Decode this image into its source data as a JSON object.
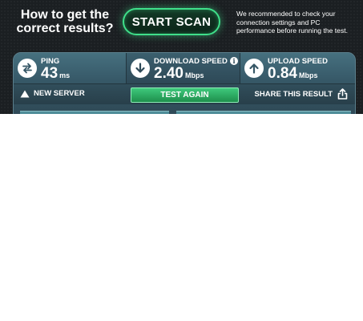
{
  "promo": {
    "heading": "How to get the correct results?",
    "cta_label": "START SCAN",
    "note": "We recommended to check your connection settings and PC performance before running the test.",
    "accent_color": "#3fe08a"
  },
  "results": {
    "ping": {
      "label": "PING",
      "value": "43",
      "unit": "ms",
      "icon": "exchange-arrows-icon"
    },
    "download": {
      "label": "DOWNLOAD SPEED",
      "value": "2.40",
      "unit": "Mbps",
      "icon": "arrow-down-icon",
      "info_icon": "info-icon"
    },
    "upload": {
      "label": "UPLOAD SPEED",
      "value": "0.84",
      "unit": "Mbps",
      "icon": "arrow-up-icon"
    }
  },
  "actions": {
    "new_server": "NEW SERVER",
    "test_again": "TEST AGAIN",
    "share": "SHARE THIS RESULT"
  },
  "colors": {
    "banner_bg": "#1b1f22",
    "panel": "#3d6270",
    "test_again_green": "#2bb366"
  }
}
